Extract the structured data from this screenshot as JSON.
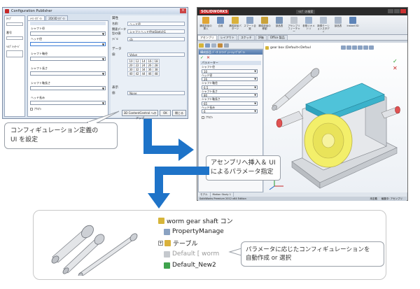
{
  "config_publisher": {
    "title": "Configuration Publisher",
    "close": "×",
    "left_panel": {
      "labels": [
        "ﾀｲﾌﾟ",
        "番号",
        "ﾍﾙﾌﾟﾒｯｾｰｼﾞ"
      ]
    },
    "tabs": [
      "ﾒｲﾝ ﾀﾌﾞｲﾝ",
      "2D/3D ﾀﾌﾞｲﾝ"
    ],
    "fields": [
      "シャフト径",
      "ヘッド径",
      "シャフト軸径",
      "シャフト長さ",
      "シャフト軸長さ",
      "ヘッド長み"
    ],
    "checkbox": "ﾅｻﾖﾅｼ",
    "right": {
      "header": "属性",
      "rows": [
        {
          "key": "名前:",
          "value": "ヘッド径"
        },
        {
          "key": "関連データ型の値:",
          "value": "シャフトヘッド径@Sketch1"
        },
        {
          "key": "ﾗﾍﾞﾙ:",
          "value": "cb"
        }
      ],
      "data_header": "データ",
      "data_key": "値:",
      "data_value": "Value",
      "grid_values": [
        "10",
        "12",
        "14",
        "16",
        "18",
        "20",
        "22",
        "24",
        "26",
        "28",
        "30",
        "32",
        "34",
        "36",
        "38",
        "40",
        "42",
        "44",
        "46",
        "48"
      ],
      "extra_key": "表示",
      "extra_label": "値:",
      "extra_value": "None"
    },
    "buttons": [
      "3D ContentCentral へのアップ",
      "OK",
      "閉じる"
    ]
  },
  "callout_ui": {
    "text_line1": "コンフィギュレーション定義の",
    "text_line2": "UI を設定"
  },
  "solidworks": {
    "logo": "SOLIDWORKS",
    "search": "ﾍﾙﾌﾟ の検索",
    "ribbon": [
      "構成部品の挿入",
      "合致",
      "構成部品パターン",
      "スマート合致",
      "構成部品の移動",
      "部品表",
      "アセンブリフィーチャー",
      "参照ジオメトリ",
      "新規モーションスタディ",
      "部品表",
      "Instant3D"
    ],
    "cmd_tabs": [
      "アセンブリ",
      "レイアウト",
      "スケッチ",
      "評価",
      "Office 製品"
    ],
    "pm_title": "構成部品 ﾃﾞｰﾀ ｺﾝﾌｨｷﾞｭﾚｰｼｮﾝﾌﾟﾛﾊﾟﾃｨ",
    "ok": "✓",
    "cancel": "✕",
    "param_header": "パラメーター",
    "params": [
      {
        "label": "シャフト径",
        "value": "10"
      },
      {
        "label": "ヘッド径",
        "value": "26"
      },
      {
        "label": "シャフト軸径",
        "value": "6.5"
      },
      {
        "label": "シャフト長さ",
        "value": "80"
      },
      {
        "label": "シャフト軸長さ",
        "value": "65"
      },
      {
        "label": "ヘッド長み",
        "value": "6"
      }
    ],
    "pm_checkbox": "ﾅｻﾖﾅｼ",
    "model_tree": "gear box  (Default<Defaul",
    "bottom_tabs": [
      "モデル",
      "Motion Study 1"
    ],
    "status_left": "SolidWorks Premium 2012 x64 Edition",
    "status_right": [
      "未定義",
      "編集中: アセンブリ"
    ]
  },
  "callout_asm": {
    "text_line1": "アセンブリへ挿入＆ UI",
    "text_line2": "によるパラメータ指定"
  },
  "bottom": {
    "tree_root": "worm gear shaft  コン",
    "tree_items": [
      "PropertyManage",
      "テーブル",
      "Default [ worm",
      "Default_New2"
    ],
    "callout_line1": "パラメータに応じたコンフィギュレーションを",
    "callout_line2": "自動作成 or 選択"
  }
}
